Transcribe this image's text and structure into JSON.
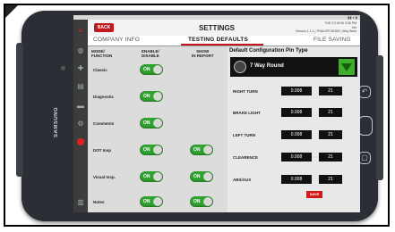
{
  "device": {
    "brand": "SAMSUNG"
  },
  "header": {
    "back_label": "BACK",
    "title": "SETTINGS",
    "meta_line1": "TUE 07/19/16 3:36 PM",
    "meta_line2": "Ver",
    "meta_line3": "Version 1.1.1 | TRAILER MODE | Way Back"
  },
  "tabs": [
    "COMPANY INFO",
    "TESTING DEFAULTS",
    "FILE SAVING"
  ],
  "modes": {
    "col_mode": "MODE/\nFUNCTION",
    "col_enable": "ENABLE/\nDISABLE",
    "col_report": "SHOW\nIN REPORT",
    "rows": [
      {
        "label": "Classic",
        "enable": "ON",
        "report": ""
      },
      {
        "label": "Diagnostic",
        "enable": "ON",
        "report": ""
      },
      {
        "label": "Comments",
        "enable": "ON",
        "report": ""
      },
      {
        "label": "DOT Insp",
        "enable": "ON",
        "report": "ON"
      },
      {
        "label": "Visual Insp.",
        "enable": "ON",
        "report": "ON"
      },
      {
        "label": "Notes",
        "enable": "ON",
        "report": "ON"
      }
    ]
  },
  "config": {
    "title": "Default Configuration Pin Type",
    "selected": "7 Way Round",
    "pins": [
      {
        "label": "RIGHT TURN",
        "v1": "0.008",
        "v2": "21"
      },
      {
        "label": "BRAKE LIGHT",
        "v1": "0.008",
        "v2": "21"
      },
      {
        "label": "LEFT TURN",
        "v1": "0.008",
        "v2": "21"
      },
      {
        "label": "CLEARENCE",
        "v1": "0.008",
        "v2": "21"
      },
      {
        "label": "ABS/AUX",
        "v1": "0.008",
        "v2": "21"
      }
    ],
    "save_label": "SAVE"
  }
}
